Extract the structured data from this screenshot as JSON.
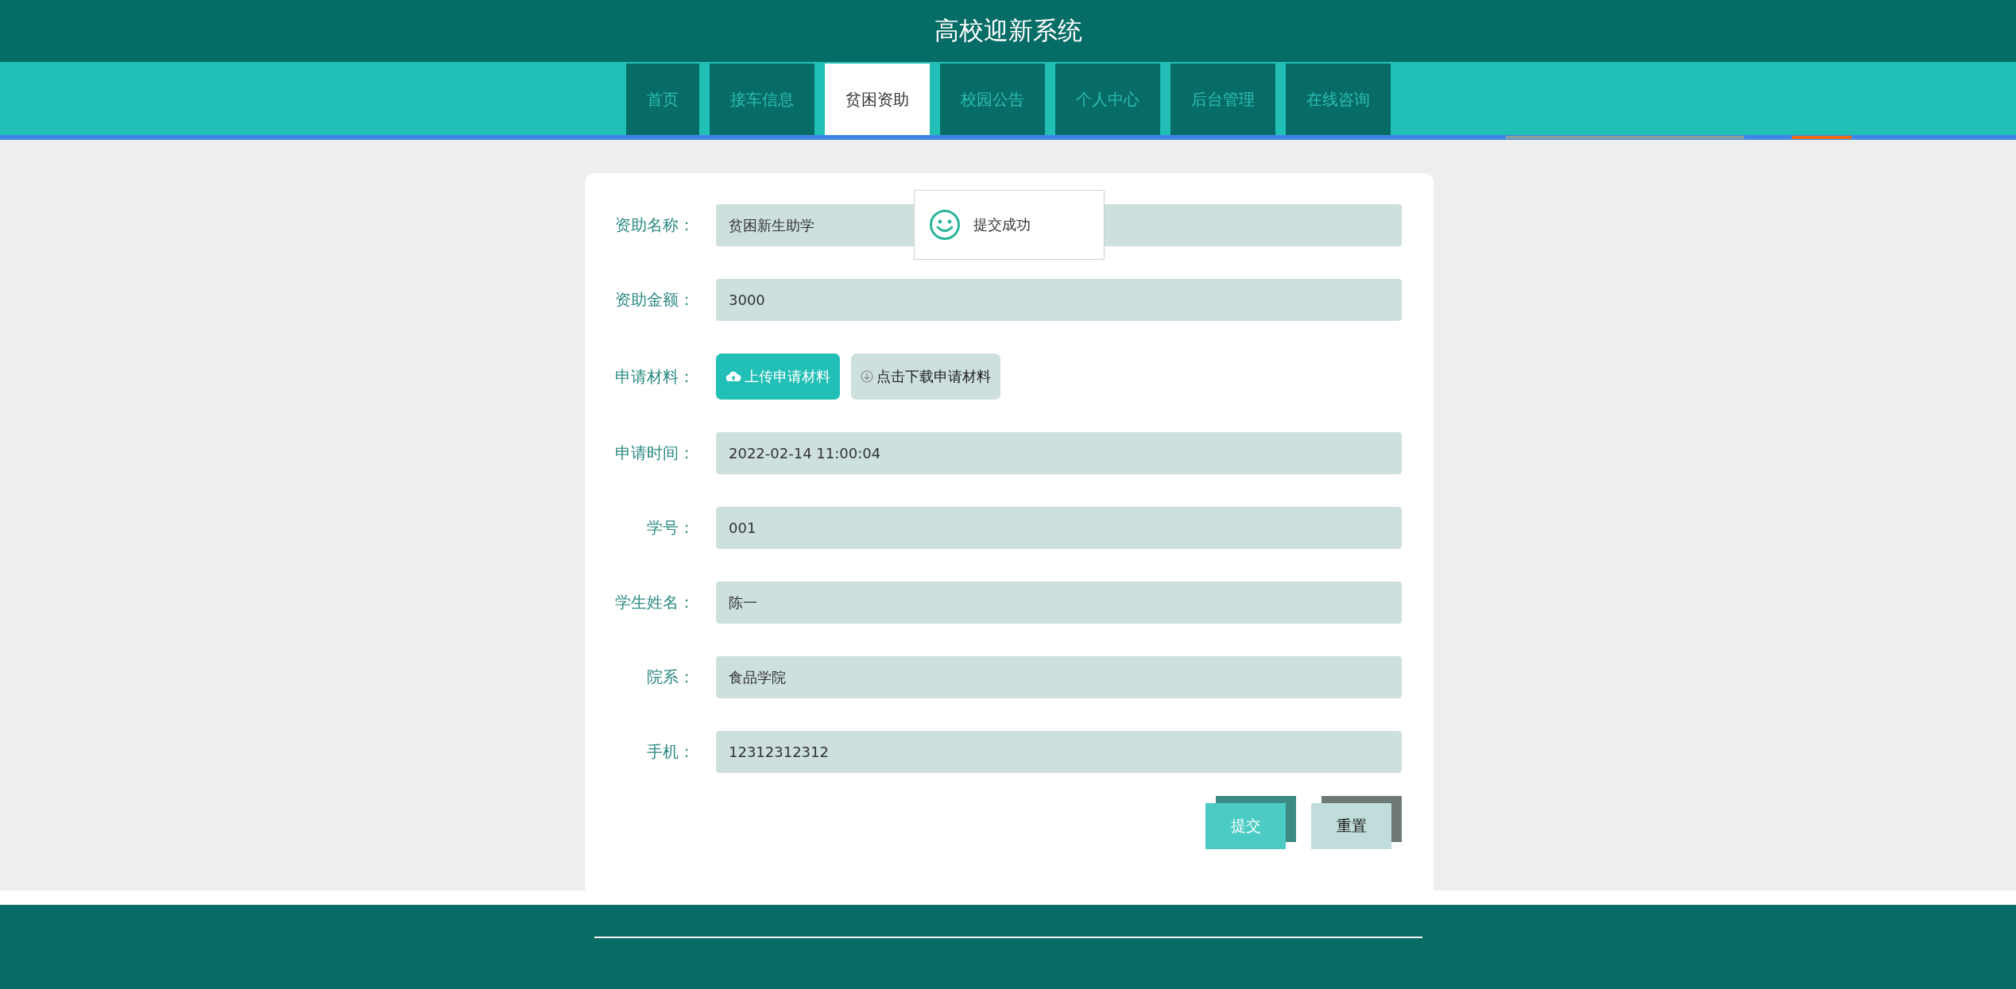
{
  "header": {
    "title": "高校迎新系统"
  },
  "tabs": [
    {
      "label": "首页",
      "selected": false
    },
    {
      "label": "接车信息",
      "selected": false
    },
    {
      "label": "贫困资助",
      "selected": true
    },
    {
      "label": "校园公告",
      "selected": false
    },
    {
      "label": "个人中心",
      "selected": false
    },
    {
      "label": "后台管理",
      "selected": false
    },
    {
      "label": "在线咨询",
      "selected": false
    }
  ],
  "form": {
    "rows": [
      {
        "kind": "text",
        "label": "资助名称：",
        "value": "贫困新生助学"
      },
      {
        "kind": "text",
        "label": "资助金额：",
        "value": "3000"
      },
      {
        "kind": "files",
        "label": "申请材料：",
        "upload": "上传申请材料",
        "download": "点击下载申请材料"
      },
      {
        "kind": "text",
        "label": "申请时间：",
        "value": "2022-02-14 11:00:04"
      },
      {
        "kind": "text",
        "label": "学号：",
        "value": "001"
      },
      {
        "kind": "text",
        "label": "学生姓名：",
        "value": "陈一"
      },
      {
        "kind": "text",
        "label": "院系：",
        "value": "食品学院"
      },
      {
        "kind": "text",
        "label": "手机：",
        "value": "12312312312"
      }
    ],
    "buttons": [
      {
        "kind": "submit",
        "label": "提交"
      },
      {
        "kind": "reset",
        "label": "重置"
      }
    ]
  },
  "toast": {
    "message": "提交成功"
  }
}
